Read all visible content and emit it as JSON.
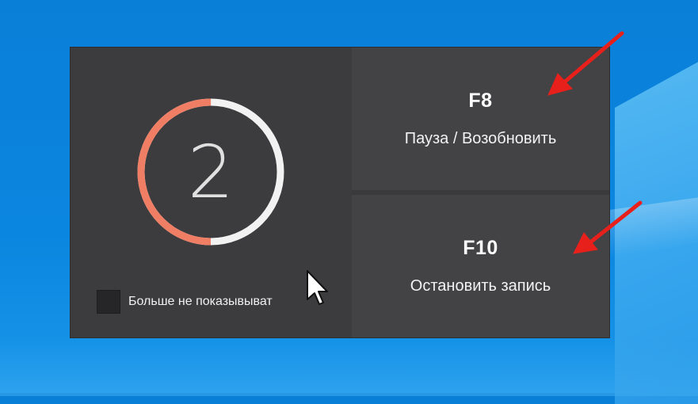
{
  "countdown": {
    "value": "2",
    "progress": 0.5
  },
  "checkbox": {
    "label": "Больше не показывыват",
    "checked": false
  },
  "hotkeys": [
    {
      "key": "F8",
      "label": "Пауза / Возобновить"
    },
    {
      "key": "F10",
      "label": "Остановить запись"
    }
  ],
  "colors": {
    "ring_active": "#f07e64",
    "ring_track": "#f2f2f2",
    "dialog_bg": "#3c3c3e",
    "button_bg": "#434345",
    "arrow": "#e8201c",
    "desktop": "#0b86e0"
  },
  "icons": [
    "mouse-cursor-icon",
    "red-arrow-icon"
  ]
}
